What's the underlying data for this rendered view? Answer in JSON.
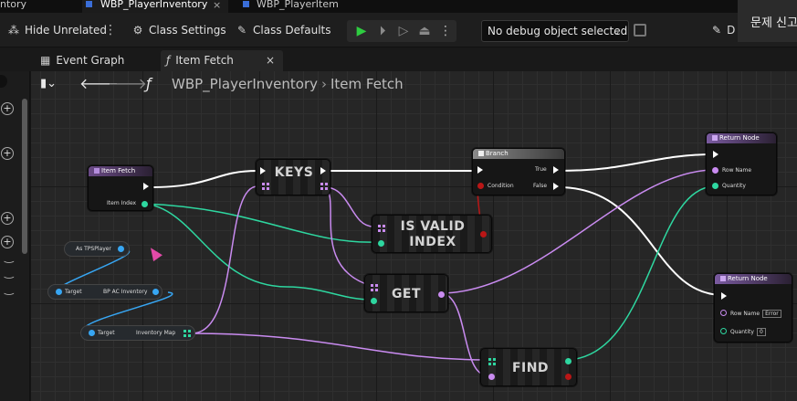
{
  "doc_tabs": [
    {
      "label": "ntory"
    },
    {
      "label": "WBP_PlayerInventory",
      "active": true
    },
    {
      "label": "WBP_PlayerItem"
    }
  ],
  "toolbar": {
    "hide_unrelated": "Hide Unrelated",
    "class_settings": "Class Settings",
    "class_defaults": "Class Defaults",
    "debug_select": "No debug object selected",
    "diff": "D",
    "popup_text": "문제 신고"
  },
  "graph_tabs": {
    "event_graph": "Event Graph",
    "item_fetch": "Item Fetch"
  },
  "breadcrumb": {
    "root": "WBP_PlayerInventory",
    "current": "Item Fetch"
  },
  "nodes": {
    "item_fetch": {
      "title": "Item Fetch",
      "pin_item_index": "Item Index"
    },
    "keys": {
      "title": "KEYS"
    },
    "is_valid": {
      "title": "IS VALID INDEX"
    },
    "get": {
      "title": "GET"
    },
    "find": {
      "title": "FIND"
    },
    "branch": {
      "title": "Branch",
      "pin_condition": "Condition",
      "pin_true": "True",
      "pin_false": "False"
    },
    "return_top": {
      "title": "Return Node",
      "pin_row_name": "Row Name",
      "pin_quantity": "Quantity"
    },
    "return_bottom": {
      "title": "Return Node",
      "pin_row_name": "Row Name",
      "row_name_value": "Error",
      "pin_quantity": "Quantity",
      "quantity_value": "0"
    },
    "as_tps_player": {
      "label": "As TPSPlayer"
    },
    "bp_ac_inventory": {
      "target": "Target",
      "output": "BP AC Inventory"
    },
    "inventory_map": {
      "target": "Target",
      "output": "Inventory Map"
    }
  },
  "colors": {
    "exec_wire": "#ffffff",
    "integer_wire": "#2ed7a0",
    "name_wire": "#c98bf0",
    "object_wire": "#37a6f3"
  }
}
